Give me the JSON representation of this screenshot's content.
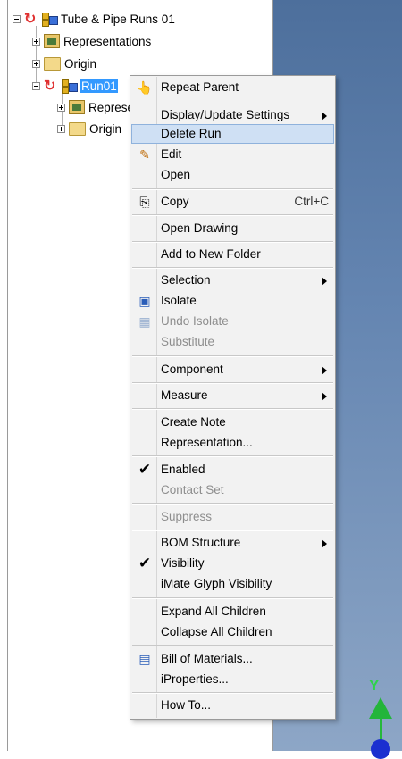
{
  "browser": {
    "root": {
      "label": "Tube & Pipe Runs 01"
    },
    "items": [
      {
        "label": "Representations"
      },
      {
        "label": "Origin"
      },
      {
        "label": "Run01"
      },
      {
        "label": "Representations"
      },
      {
        "label": "Origin"
      }
    ]
  },
  "viewcube": {
    "y_axis_label": "Y"
  },
  "context_menu": {
    "items": [
      {
        "label": "Repeat Parent",
        "icon": "repeat-parent-icon"
      },
      {
        "label": "Display/Update Settings",
        "submenu": true
      },
      {
        "label": "Delete Run",
        "highlighted": true
      },
      {
        "label": "Edit",
        "icon": "edit-icon"
      },
      {
        "label": "Open"
      },
      {
        "label": "Copy",
        "shortcut": "Ctrl+C",
        "icon": "copy-icon"
      },
      {
        "label": "Open Drawing"
      },
      {
        "label": "Add to New Folder"
      },
      {
        "label": "Selection",
        "submenu": true
      },
      {
        "label": "Isolate",
        "icon": "isolate-icon"
      },
      {
        "label": "Undo Isolate",
        "disabled": true,
        "icon": "undo-isolate-icon"
      },
      {
        "label": "Substitute",
        "disabled": true
      },
      {
        "label": "Component",
        "submenu": true
      },
      {
        "label": "Measure",
        "submenu": true
      },
      {
        "label": "Create Note"
      },
      {
        "label": "Representation..."
      },
      {
        "label": "Enabled",
        "checked": true
      },
      {
        "label": "Contact Set",
        "disabled": true
      },
      {
        "label": "Suppress",
        "disabled": true
      },
      {
        "label": "BOM Structure",
        "submenu": true
      },
      {
        "label": "Visibility",
        "checked": true
      },
      {
        "label": "iMate Glyph Visibility"
      },
      {
        "label": "Expand All Children"
      },
      {
        "label": "Collapse All Children"
      },
      {
        "label": "Bill of Materials...",
        "icon": "bill-of-materials-icon"
      },
      {
        "label": "iProperties..."
      },
      {
        "label": "How To..."
      }
    ]
  },
  "colors": {
    "highlight": "#cfe0f4",
    "selection": "#3399ff",
    "axis_green": "#23b53a"
  }
}
